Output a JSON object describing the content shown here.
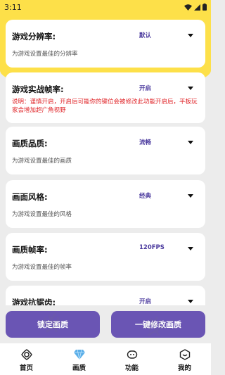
{
  "status": {
    "time": "3:11"
  },
  "settings": [
    {
      "title": "游戏分辨率:",
      "value": "默认",
      "desc": "为游戏设置最佳的分辨率"
    },
    {
      "title": "游戏实战帧率:",
      "value": "开启",
      "warning": "说明：谨慎开启，开启后可能你的键位会被修改此功能开启后，平板玩家会增加超广角视野"
    },
    {
      "title": "画质品质:",
      "value": "流畅",
      "desc": "为游戏设置最佳的画质"
    },
    {
      "title": "画面风格:",
      "value": "经典",
      "desc": "为游戏设置最佳的风格"
    },
    {
      "title": "画质帧率:",
      "value": "120FPS",
      "desc": "为游戏设置最佳的帧率"
    },
    {
      "title": "游戏抗锯齿:",
      "value": "开启"
    }
  ],
  "actions": {
    "lock": "锁定画质",
    "apply": "一键修改画质"
  },
  "tabs": [
    {
      "label": "首页",
      "icon": "home-icon"
    },
    {
      "label": "画质",
      "icon": "diamond-icon"
    },
    {
      "label": "功能",
      "icon": "function-icon"
    },
    {
      "label": "我的",
      "icon": "profile-icon"
    }
  ],
  "colors": {
    "accent": "#6a55b4",
    "header": "#fde049",
    "warning": "#e0262a",
    "value": "#4b3a9e"
  }
}
